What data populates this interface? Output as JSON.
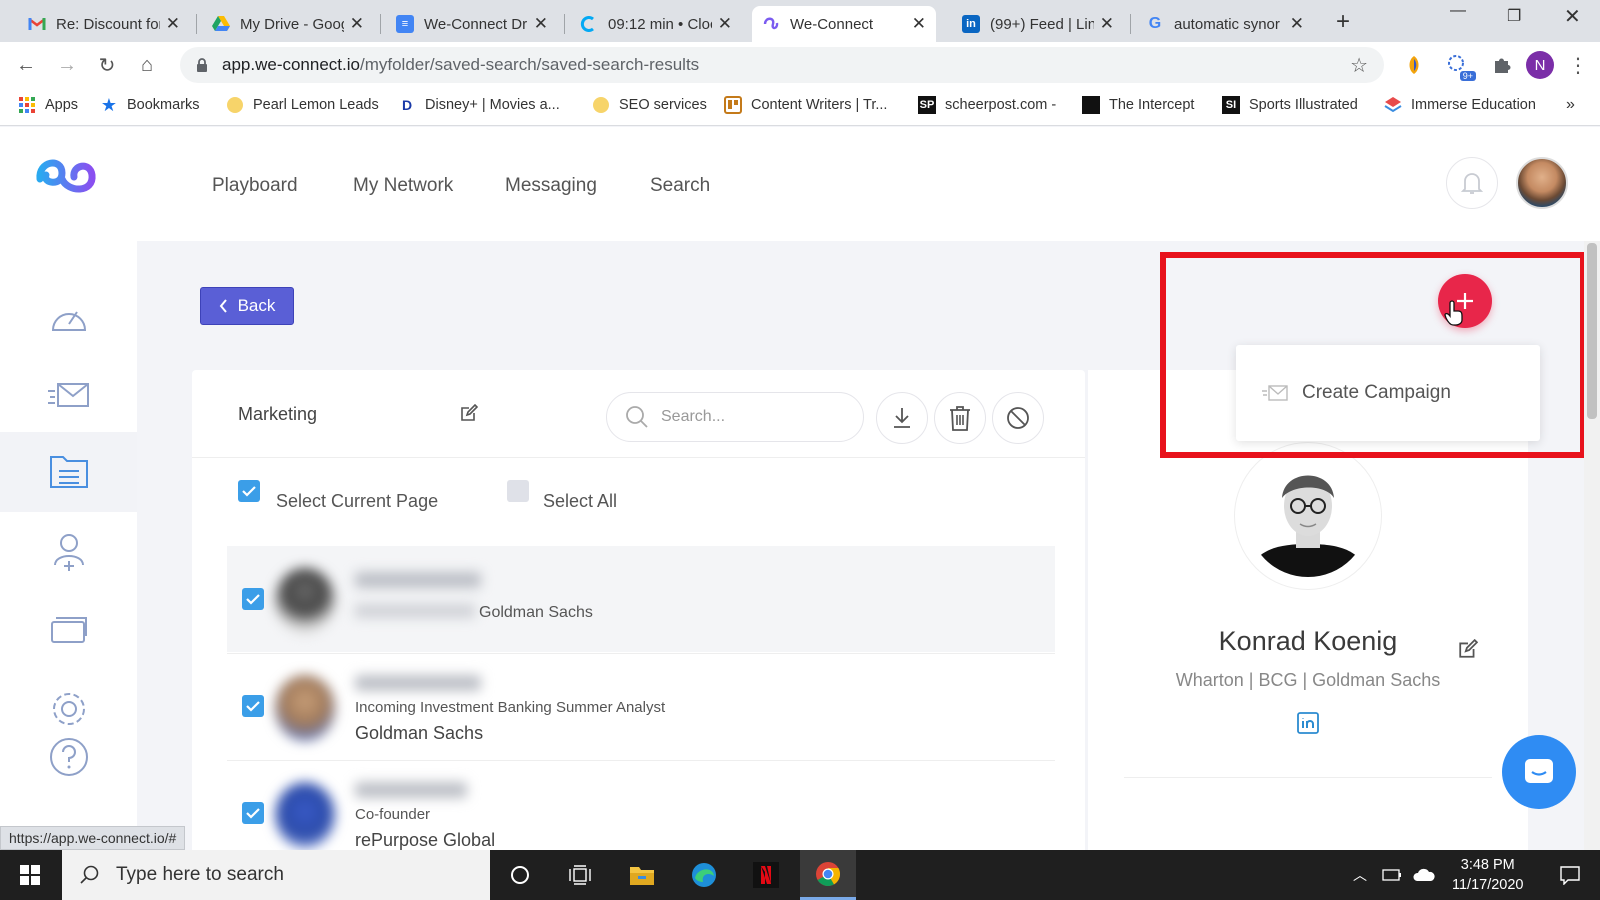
{
  "browser": {
    "tabs": [
      {
        "title": "Re: Discount for",
        "icon": "gmail-icon",
        "color": "#ea4335"
      },
      {
        "title": "My Drive - Goog",
        "icon": "google-drive-icon",
        "color": "#1fa463"
      },
      {
        "title": "We-Connect Dr",
        "icon": "google-docs-icon",
        "color": "#4285f4"
      },
      {
        "title": "09:12 min • Cloc",
        "icon": "clockify-icon",
        "color": "#03a9f4"
      },
      {
        "title": "We-Connect",
        "icon": "we-connect-icon",
        "color": "#7b5cf0"
      },
      {
        "title": "(99+) Feed | Lin",
        "icon": "linkedin-icon",
        "color": "#0a66c2"
      },
      {
        "title": "automatic synor",
        "icon": "google-icon",
        "color": "#4285f4"
      }
    ],
    "active_tab": 4,
    "url_host": "app.we-connect.io",
    "url_path": "/myfolder/saved-search/saved-search-results",
    "profile_initial": "N",
    "extension_badge": "9+"
  },
  "bookmarks": [
    {
      "label": "Apps",
      "icon": "apps-grid-icon"
    },
    {
      "label": "Bookmarks",
      "icon": "star-icon"
    },
    {
      "label": "Pearl Lemon Leads",
      "icon": "pearl-lemon-icon"
    },
    {
      "label": "Disney+ | Movies a...",
      "icon": "disney-plus-icon"
    },
    {
      "label": "SEO services",
      "icon": "seo-icon"
    },
    {
      "label": "Content Writers | Tr...",
      "icon": "trello-icon"
    },
    {
      "label": "scheerpost.com -",
      "icon": "scheerpost-icon"
    },
    {
      "label": "The Intercept",
      "icon": "intercept-icon"
    },
    {
      "label": "Sports Illustrated",
      "icon": "si-icon"
    },
    {
      "label": "Immerse Education",
      "icon": "immerse-icon"
    }
  ],
  "app": {
    "nav": [
      "Playboard",
      "My Network",
      "Messaging",
      "Search"
    ],
    "back_label": "Back",
    "list_name": "Marketing",
    "search_placeholder": "Search...",
    "select_current_page": "Select Current Page",
    "select_all": "Select All",
    "people": [
      {
        "title": "",
        "company": "Goldman Sachs",
        "checked": true
      },
      {
        "title": "Incoming Investment Banking Summer Analyst",
        "company": "Goldman Sachs",
        "checked": true
      },
      {
        "title": "Co-founder",
        "company": "rePurpose Global",
        "checked": true
      }
    ],
    "profile": {
      "name": "Konrad Koenig",
      "subtitle": "Wharton | BCG | Goldman Sachs"
    },
    "popover_label": "Create Campaign",
    "status_url": "https://app.we-connect.io/#"
  },
  "taskbar": {
    "search_placeholder": "Type here to search",
    "time": "3:48 PM",
    "date": "11/17/2020"
  },
  "colors": {
    "accent": "#5a5fd6",
    "fab": "#e8264a",
    "highlight_box": "#e8121c",
    "checkbox": "#3b9ee8"
  }
}
